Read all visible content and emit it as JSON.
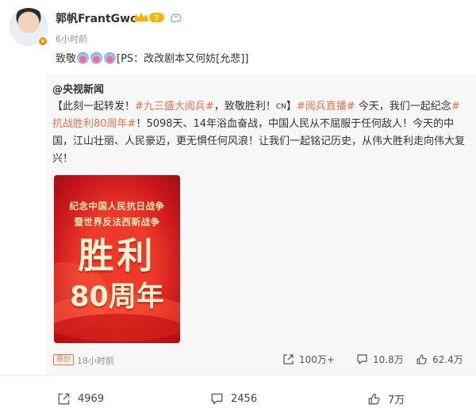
{
  "post": {
    "author": "郭帆FrantGwo",
    "vip_level": "7",
    "avatar_badge": "v",
    "time": "6小时前",
    "content_prefix": "致敬",
    "content_suffix": "[PS：改改剧本又何妨[允悲]]"
  },
  "repost": {
    "author": "@央视新闻",
    "text": {
      "p1": "【此刻一起转发！",
      "tag1": "#九三盛大阅兵#",
      "p2": "，致敬胜利！",
      "cn": "CN",
      "p3": "】",
      "tag2": "#阅兵直播#",
      "p4": " 今天，我们一起纪念",
      "tag3": "#抗战胜利80周年#",
      "p5": "！5098天、14年浴血奋战，中国人民从不屈服于任何敌人！今天的中国，江山壮丽、人民豪迈，更无惧任何风浪！让我们一起铭记历史，从伟大胜利走向伟大复兴！"
    },
    "poster": {
      "line1": "纪念中国人民抗日战争",
      "line2": "暨世界反法西斯战争",
      "big": "胜利",
      "number": "80周年"
    },
    "source_badge": "原创",
    "time": "18小时前",
    "stats": {
      "forward": "100万+",
      "comment": "10.8万",
      "like": "62.4万"
    }
  },
  "toolbar": {
    "forward": "4969",
    "comment": "2456",
    "like": "7万"
  },
  "colors": {
    "accent": "#eb7350",
    "vip": "#ff8200",
    "poster_red": "#d81e1e"
  },
  "icons": {
    "crown": "vip-crown-icon",
    "emoji": "emoji-badge-icon",
    "forward": "forward-icon",
    "comment": "comment-icon",
    "like": "like-icon"
  }
}
